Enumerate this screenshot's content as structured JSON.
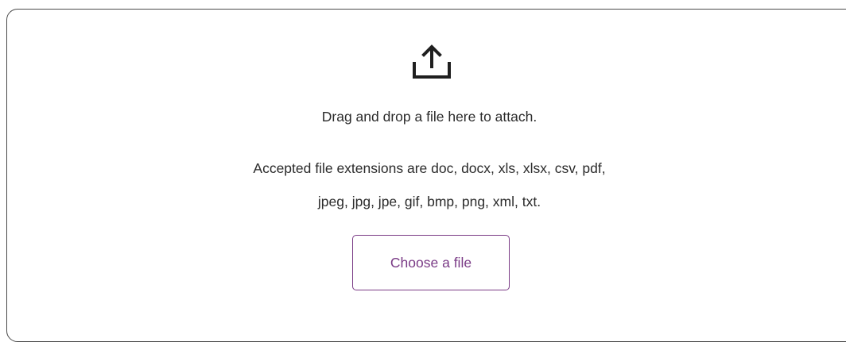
{
  "dropzone": {
    "icon": "upload-icon",
    "instruction": "Drag and drop a file here to attach.",
    "extensions_line1": "Accepted file extensions are doc, docx, xls, xlsx, csv, pdf,",
    "extensions_line2": "jpeg, jpg, jpe, gif, bmp, png, xml, txt.",
    "choose_button_label": "Choose a file"
  },
  "colors": {
    "accent": "#7a3b86",
    "text": "#2b2b2b",
    "border": "#4a4a4a"
  }
}
